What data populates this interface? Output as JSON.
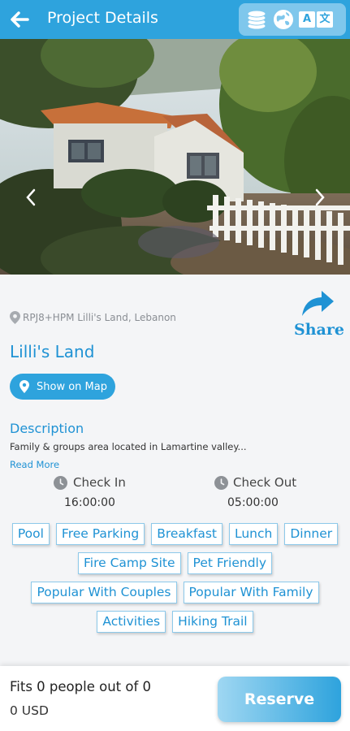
{
  "header": {
    "title": "Project Details",
    "translate_glyphs": [
      "A",
      "文"
    ]
  },
  "location": {
    "address": "RPJ8+HPM Lilli's Land, Lebanon"
  },
  "share": {
    "label": "Share"
  },
  "project": {
    "name": "Lilli's Land",
    "map_button": "Show on Map"
  },
  "description": {
    "label": "Description",
    "text": "Family & groups area located in Lamartine valley...",
    "read_more": "Read More"
  },
  "check_in": {
    "label": "Check In",
    "time": "16:00:00"
  },
  "check_out": {
    "label": "Check Out",
    "time": "05:00:00"
  },
  "amenities": [
    "Pool",
    "Free Parking",
    "Breakfast",
    "Lunch",
    "Dinner",
    "Fire Camp Site",
    "Pet Friendly",
    "Popular With Couples",
    "Popular With Family",
    "Activities",
    "Hiking Trail"
  ],
  "footer": {
    "fits": "Fits 0 people out of 0",
    "price": "0 USD",
    "reserve": "Reserve"
  },
  "colors": {
    "accent": "#2ea3dd",
    "link": "#1f92d4",
    "tag_border": "#8dc9ea"
  }
}
